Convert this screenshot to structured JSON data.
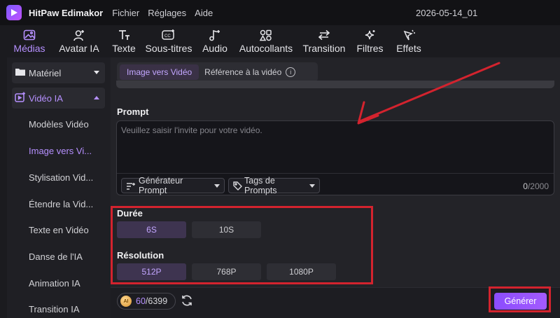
{
  "app": {
    "name": "HitPaw Edimakor",
    "menu": [
      "Fichier",
      "Réglages",
      "Aide"
    ],
    "project": "2026-05-14_01"
  },
  "toolbar": {
    "items": [
      {
        "label": "Médias",
        "icon": "media-icon",
        "active": true
      },
      {
        "label": "Avatar IA",
        "icon": "avatar-icon"
      },
      {
        "label": "Texte",
        "icon": "text-icon"
      },
      {
        "label": "Sous-titres",
        "icon": "subtitles-icon"
      },
      {
        "label": "Audio",
        "icon": "audio-icon"
      },
      {
        "label": "Autocollants",
        "icon": "stickers-icon"
      },
      {
        "label": "Transition",
        "icon": "transition-icon"
      },
      {
        "label": "Filtres",
        "icon": "filters-icon"
      },
      {
        "label": "Effets",
        "icon": "effects-icon"
      }
    ]
  },
  "sidebar": {
    "sections": [
      {
        "label": "Matériel",
        "icon": "folder-icon",
        "expanded": false
      },
      {
        "label": "Vidéo IA",
        "icon": "ai-video-icon",
        "expanded": true
      }
    ],
    "items": [
      {
        "label": "Modèles Vidéo"
      },
      {
        "label": "Image vers Vi...",
        "active": true
      },
      {
        "label": "Stylisation Vid..."
      },
      {
        "label": "Étendre la Vid..."
      },
      {
        "label": "Texte en Vidéo"
      },
      {
        "label": "Danse de l'IA"
      },
      {
        "label": "Animation IA"
      },
      {
        "label": "Transition IA"
      }
    ]
  },
  "main": {
    "tabs": [
      {
        "label": "Image vers Vidéo",
        "active": true
      },
      {
        "label": "Référence à la vidéo"
      }
    ],
    "prompt": {
      "label": "Prompt",
      "placeholder": "Veuillez saisir l'invite pour votre vidéo.",
      "value": "",
      "generator_label": "Générateur Prompt",
      "tags_label": "Tags de Prompts",
      "count_current": "0",
      "count_max": "/2000"
    },
    "duration": {
      "label": "Durée",
      "options": [
        {
          "label": "6S",
          "selected": true
        },
        {
          "label": "10S"
        }
      ]
    },
    "resolution": {
      "label": "Résolution",
      "options": [
        {
          "label": "512P",
          "selected": true
        },
        {
          "label": "768P"
        },
        {
          "label": "1080P"
        }
      ]
    },
    "footer": {
      "credits_used": "60",
      "credits_total": "/6399",
      "coin_text": "AI",
      "generate_label": "Générer"
    }
  },
  "colors": {
    "accent": "#b690ff",
    "annotation": "#d3232e",
    "generate": "#9a55ff"
  }
}
